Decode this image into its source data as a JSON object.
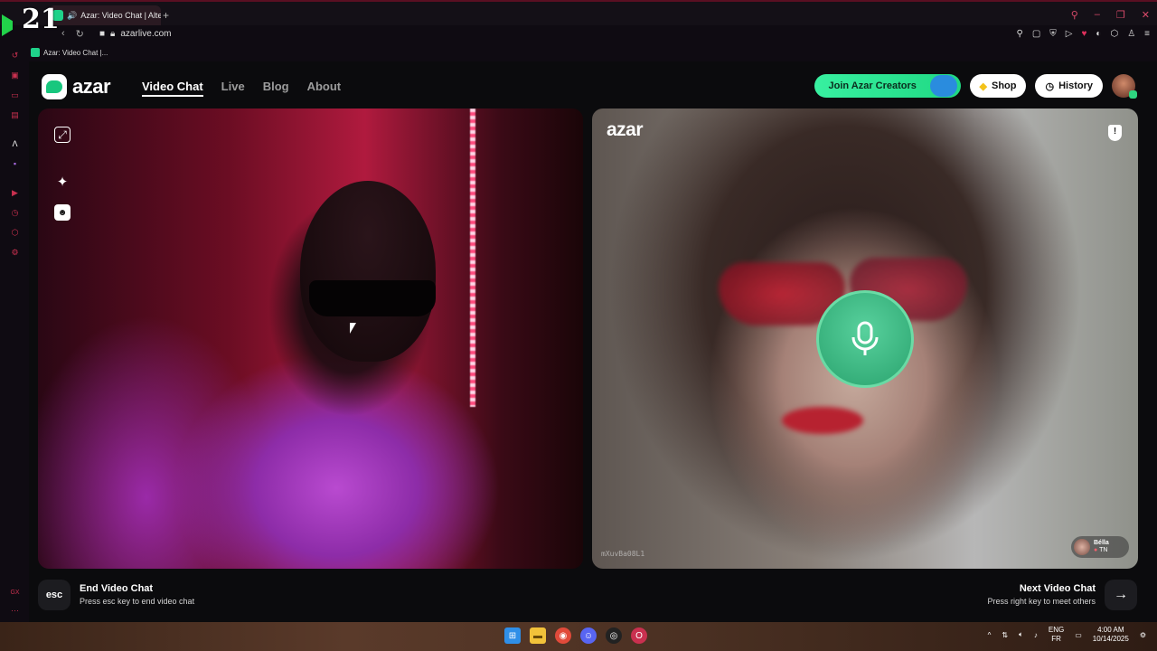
{
  "overlay_badge": "21",
  "browser": {
    "tab_title": "Azar: Video Chat | Alte",
    "new_tab": "+",
    "address": "azarlive.com",
    "bookmark": "Azar: Video Chat |...",
    "window_controls": [
      "search-icon",
      "minimize-icon",
      "restore-icon",
      "close-icon"
    ],
    "extensions": [
      "pin-icon",
      "screenshot-icon",
      "shield-icon",
      "play-icon",
      "heart-icon",
      "vpn-icon",
      "puzzle-icon",
      "profile-icon",
      "menu-icon"
    ]
  },
  "left_sidebar": {
    "icons": [
      "history-icon",
      "bag-icon",
      "chat-icon",
      "news-icon",
      "aria-icon",
      "twitch-icon",
      "play-icon",
      "clock-icon",
      "cube-icon",
      "settings-icon",
      "gx-icon",
      "more-icon"
    ],
    "gx_label": "GX"
  },
  "site": {
    "logo_text": "azar",
    "nav": [
      "Video Chat",
      "Live",
      "Blog",
      "About"
    ],
    "join_creators": "Join Azar Creators",
    "shop": "Shop",
    "history": "History",
    "colors": {
      "accent": "#1fd883",
      "background": "#0b0b0d"
    }
  },
  "left_video": {
    "controls": [
      "expand-icon",
      "sparkle-icon",
      "face-filter-icon"
    ]
  },
  "right_video": {
    "logo_text": "azar",
    "session_code": "mXuvBa08L1",
    "partner_name": "Bélla",
    "partner_country": "TN",
    "mic_state": "unmuted"
  },
  "bottom": {
    "esc_key": "esc",
    "end_title": "End Video Chat",
    "end_hint": "Press esc key to end video chat",
    "next_title": "Next Video Chat",
    "next_hint": "Press right key to meet others",
    "next_arrow": "→"
  },
  "taskbar": {
    "apps": [
      "windows-start-icon",
      "file-explorer-icon",
      "chrome-icon",
      "discord-icon",
      "obs-icon",
      "opera-gx-icon"
    ],
    "lang_top": "ENG",
    "lang_bottom": "FR",
    "time": "4:00 AM",
    "date": "10/14/2025"
  }
}
